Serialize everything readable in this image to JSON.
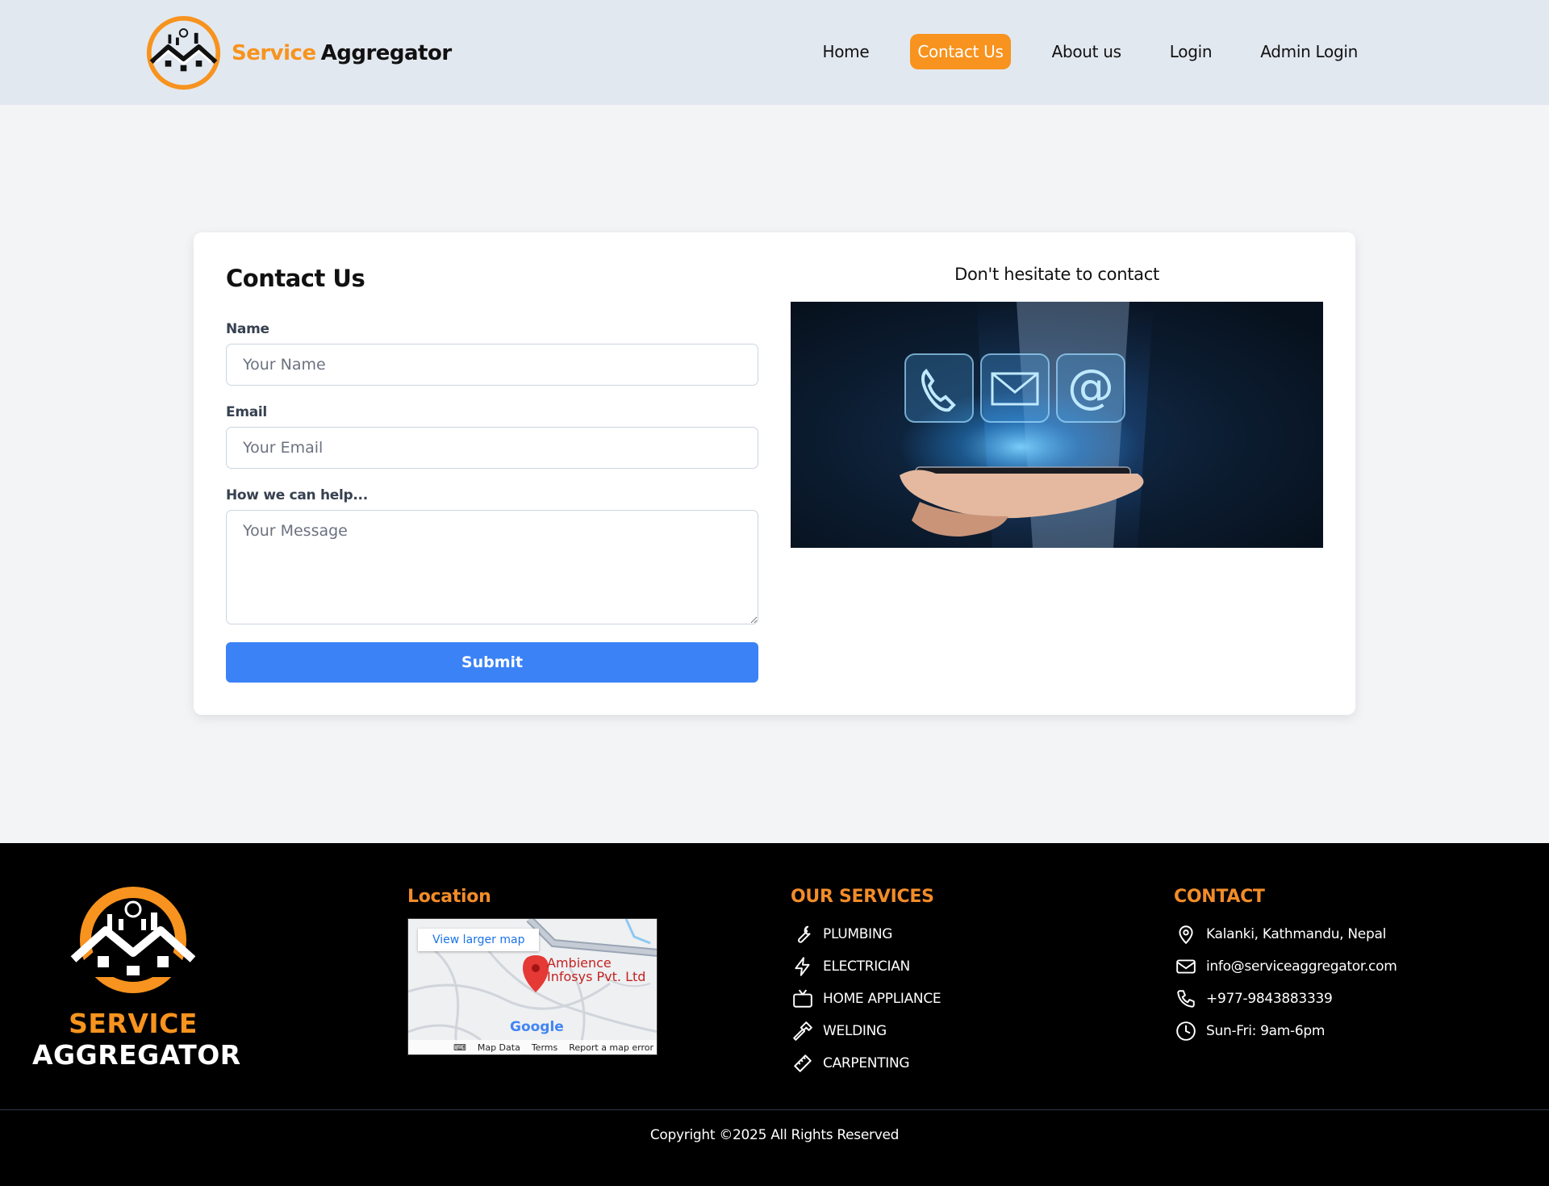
{
  "navbar": {
    "brand_part1": "Service",
    "brand_part2": "Aggregator",
    "links": [
      {
        "label": "Home",
        "active": false
      },
      {
        "label": "Contact Us",
        "active": true
      },
      {
        "label": "About us",
        "active": false
      },
      {
        "label": "Login",
        "active": false
      },
      {
        "label": "Admin Login",
        "active": false
      }
    ]
  },
  "contact_form": {
    "title": "Contact Us",
    "name_label": "Name",
    "name_placeholder": "Your Name",
    "email_label": "Email",
    "email_placeholder": "Your Email",
    "message_label": "How we can help...",
    "message_placeholder": "Your Message",
    "submit_label": "Submit"
  },
  "info": {
    "heading": "Don't hesitate to contact"
  },
  "footer": {
    "logo_line1": "SERVICE",
    "logo_line2": "AGGREGATOR",
    "location": {
      "title": "Location",
      "map_link": "View larger map",
      "map_pin_label_1": "Ambience",
      "map_pin_label_2": "Infosys Pvt. Ltd",
      "map_brand": "Google",
      "map_data": "Map Data",
      "map_terms": "Terms",
      "map_report": "Report a map error"
    },
    "services": {
      "title": "OUR SERVICES",
      "items": [
        {
          "label": "PLUMBING",
          "icon": "wrench-icon"
        },
        {
          "label": "ELECTRICIAN",
          "icon": "lightning-icon"
        },
        {
          "label": "HOME APPLIANCE",
          "icon": "tv-icon"
        },
        {
          "label": "WELDING",
          "icon": "hammer-icon"
        },
        {
          "label": "CARPENTING",
          "icon": "ruler-icon"
        }
      ]
    },
    "contact": {
      "title": "CONTACT",
      "items": [
        {
          "label": "Kalanki, Kathmandu, Nepal",
          "icon": "location-pin-icon"
        },
        {
          "label": "info@serviceaggregator.com",
          "icon": "mail-icon"
        },
        {
          "label": "+977-9843883339",
          "icon": "phone-icon"
        },
        {
          "label": "Sun-Fri: 9am-6pm",
          "icon": "clock-icon"
        }
      ]
    },
    "copyright": "Copyright ©2025 All Rights Reserved"
  },
  "colors": {
    "accent": "#f7931e",
    "primary_button": "#3b82f6",
    "navbar_bg": "#e2e8f0",
    "page_bg": "#f3f4f6",
    "footer_bg": "#000000",
    "footer_heading": "#f28c28"
  }
}
